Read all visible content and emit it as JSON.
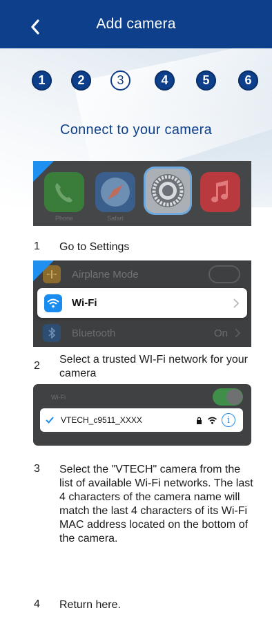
{
  "header": {
    "title": "Add camera",
    "back_icon": "chevron-left-icon"
  },
  "steps": [
    {
      "label": "1",
      "state": "done"
    },
    {
      "label": "2",
      "state": "done"
    },
    {
      "label": "3",
      "state": "current"
    },
    {
      "label": "4",
      "state": "todo"
    },
    {
      "label": "5",
      "state": "todo"
    },
    {
      "label": "6",
      "state": "todo"
    }
  ],
  "connect_title": "Connect to your camera",
  "panel_apps": {
    "apps": [
      {
        "name": "phone-app-icon",
        "label": "Phone",
        "color": "#3f8f3c"
      },
      {
        "name": "safari-app-icon",
        "label": "Safari",
        "color": "#3b6fa8"
      },
      {
        "name": "settings-app-icon",
        "label": "",
        "color": "#8e9398"
      },
      {
        "name": "music-app-icon",
        "label": "",
        "color": "#c63a3f"
      }
    ]
  },
  "panel_settings": {
    "airplane": "Airplane Mode",
    "wifi": "Wi-Fi",
    "bluetooth": "Bluetooth",
    "bluetooth_state": "On"
  },
  "panel_network": {
    "section_label": "Wi-Fi",
    "network_name": "VTECH_c9511_XXXX"
  },
  "instructions": [
    {
      "num": "1",
      "text": "Go to Settings"
    },
    {
      "num": "2",
      "text": "Select a trusted WI-Fi network for your camera"
    },
    {
      "num": "3",
      "text": "Select the \"VTECH\" camera from the list of available Wi-Fi networks. The last 4 characters of the camera name will match the last 4 characters of its Wi-Fi MAC address located on the bottom of the camera."
    },
    {
      "num": "4",
      "text": "Return here."
    }
  ],
  "colors": {
    "brand": "#0d3f8a",
    "accent": "#1f8ff0",
    "toggle_on": "#4cd964"
  }
}
